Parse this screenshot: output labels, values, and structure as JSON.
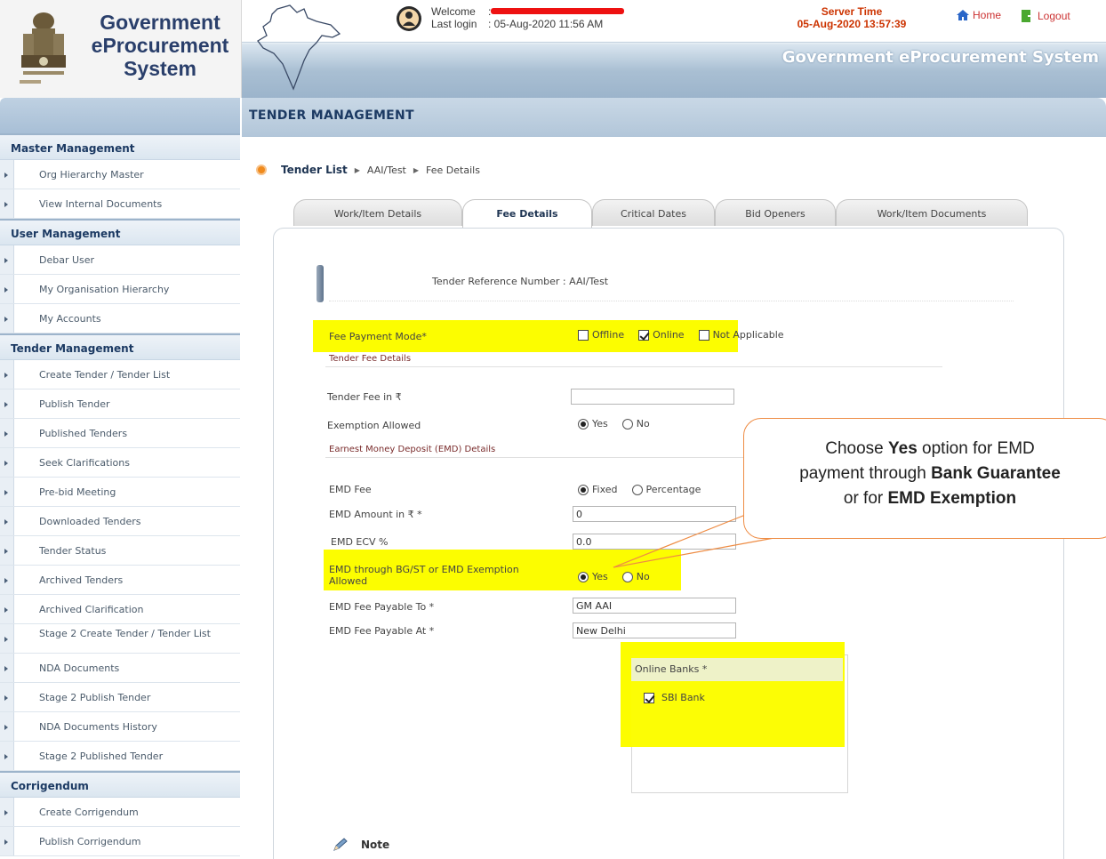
{
  "header": {
    "logo_line1": "Government",
    "logo_line2": "eProcurement",
    "logo_line3": "System",
    "welcome_label": "Welcome",
    "welcome_sep": ":",
    "last_login_label": "Last login",
    "last_login_value": ": 05-Aug-2020 11:56 AM",
    "server_time_label": "Server Time",
    "server_time_value": "05-Aug-2020 13:57:39",
    "home_label": "Home",
    "logout_label": "Logout",
    "banner_title": "Government eProcurement System"
  },
  "sidebar": {
    "sections": [
      {
        "title": "Master Management",
        "items": [
          "Org Hierarchy Master",
          "View Internal Documents"
        ]
      },
      {
        "title": "User Management",
        "items": [
          "Debar User",
          "My Organisation Hierarchy",
          "My Accounts"
        ]
      },
      {
        "title": "Tender Management",
        "items": [
          "Create Tender / Tender List",
          "Publish Tender",
          "Published Tenders",
          "Seek Clarifications",
          "Pre-bid Meeting",
          "Downloaded Tenders",
          "Tender Status",
          "Archived Tenders",
          "Archived Clarification",
          "Stage 2 Create Tender / Tender List",
          "NDA Documents",
          "Stage 2 Publish Tender",
          "NDA Documents History",
          "Stage 2 Published Tender"
        ]
      },
      {
        "title": "Corrigendum",
        "items": [
          "Create Corrigendum",
          "Publish Corrigendum"
        ]
      }
    ]
  },
  "main": {
    "title": "TENDER MANAGEMENT",
    "breadcrumb": [
      "Tender List",
      "AAI/Test",
      "Fee Details"
    ],
    "tabs": [
      "Work/Item Details",
      "Fee Details",
      "Critical Dates",
      "Bid Openers",
      "Work/Item Documents"
    ],
    "active_tab": "Fee Details",
    "tender_ref_label": "Tender Reference Number :",
    "tender_ref_value": "AAI/Test"
  },
  "form": {
    "fee_payment_mode_label": "Fee Payment Mode*",
    "fee_payment_options": [
      "Offline",
      "Online",
      "Not Applicable"
    ],
    "fee_payment_checked": [
      "Online"
    ],
    "tender_fee_section": "Tender Fee Details",
    "tender_fee_label": "Tender Fee in ₹",
    "tender_fee_value": "",
    "exemption_label": "Exemption Allowed",
    "exemption_options": [
      "Yes",
      "No"
    ],
    "exemption_selected": "Yes",
    "emd_section": "Earnest Money Deposit (EMD) Details",
    "emd_fee_label": "EMD Fee",
    "emd_fee_options": [
      "Fixed",
      "Percentage"
    ],
    "emd_fee_selected": "Fixed",
    "emd_amount_label": "EMD Amount in ₹ *",
    "emd_amount_value": "0",
    "emd_ecv_label": "EMD ECV %",
    "emd_ecv_value": "0.0",
    "emd_bg_label_1": "EMD through BG/ST or EMD Exemption",
    "emd_bg_label_2": "Allowed",
    "emd_bg_options": [
      "Yes",
      "No"
    ],
    "emd_bg_selected": "Yes",
    "emd_payable_to_label": "EMD Fee Payable To *",
    "emd_payable_to_value": "GM AAI",
    "emd_payable_at_label": "EMD Fee Payable At *",
    "emd_payable_at_value": "New Delhi",
    "online_banks_label": "Online Banks *",
    "online_banks": [
      "SBI Bank"
    ],
    "note_label": "Note"
  },
  "callout": {
    "line1_pre": "Choose ",
    "line1_bold": "Yes",
    "line1_post": " option for EMD",
    "line2_pre": "payment through ",
    "line2_bold": "Bank Guarantee",
    "line3_pre": "or for ",
    "line3_bold": "EMD Exemption"
  },
  "colors": {
    "highlight": "#fcfd00",
    "callout_border": "#ee8c44",
    "header_blue": "#1c3a63",
    "server_time": "#cc3300"
  }
}
